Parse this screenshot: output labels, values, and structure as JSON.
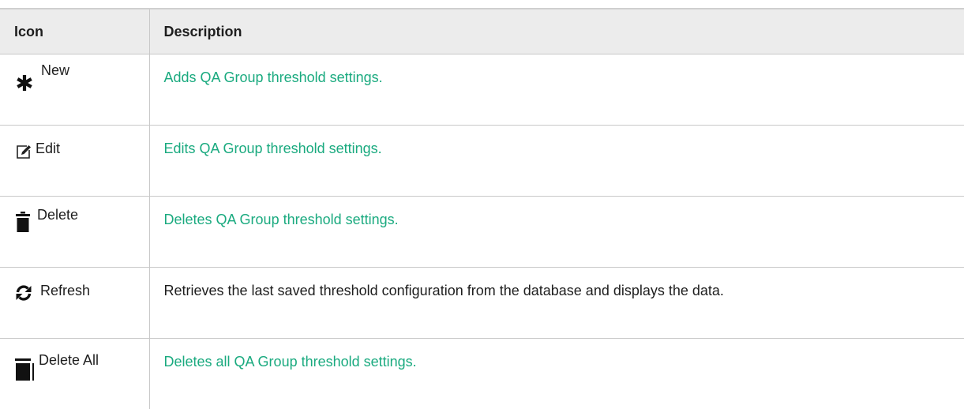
{
  "table": {
    "headers": {
      "icon": "Icon",
      "description": "Description"
    },
    "rows": [
      {
        "icon": "asterisk-icon",
        "label": "New",
        "description": "Adds QA Group threshold settings.",
        "is_link": true
      },
      {
        "icon": "edit-icon",
        "label": "Edit",
        "description": "Edits QA Group threshold settings.",
        "is_link": true
      },
      {
        "icon": "trash-icon",
        "label": "Delete",
        "description": "Deletes QA Group threshold settings.",
        "is_link": true
      },
      {
        "icon": "refresh-icon",
        "label": "Refresh",
        "description": "Retrieves the last saved threshold configuration from the database and displays the data.",
        "is_link": false
      },
      {
        "icon": "delete-all-icon",
        "label": "Delete All",
        "description": "Deletes all QA Group threshold settings.",
        "is_link": true
      }
    ]
  },
  "colors": {
    "link": "#1aaa7f",
    "header_bg": "#ececec",
    "border": "#c8c8c8",
    "text": "#1e1e1e"
  }
}
